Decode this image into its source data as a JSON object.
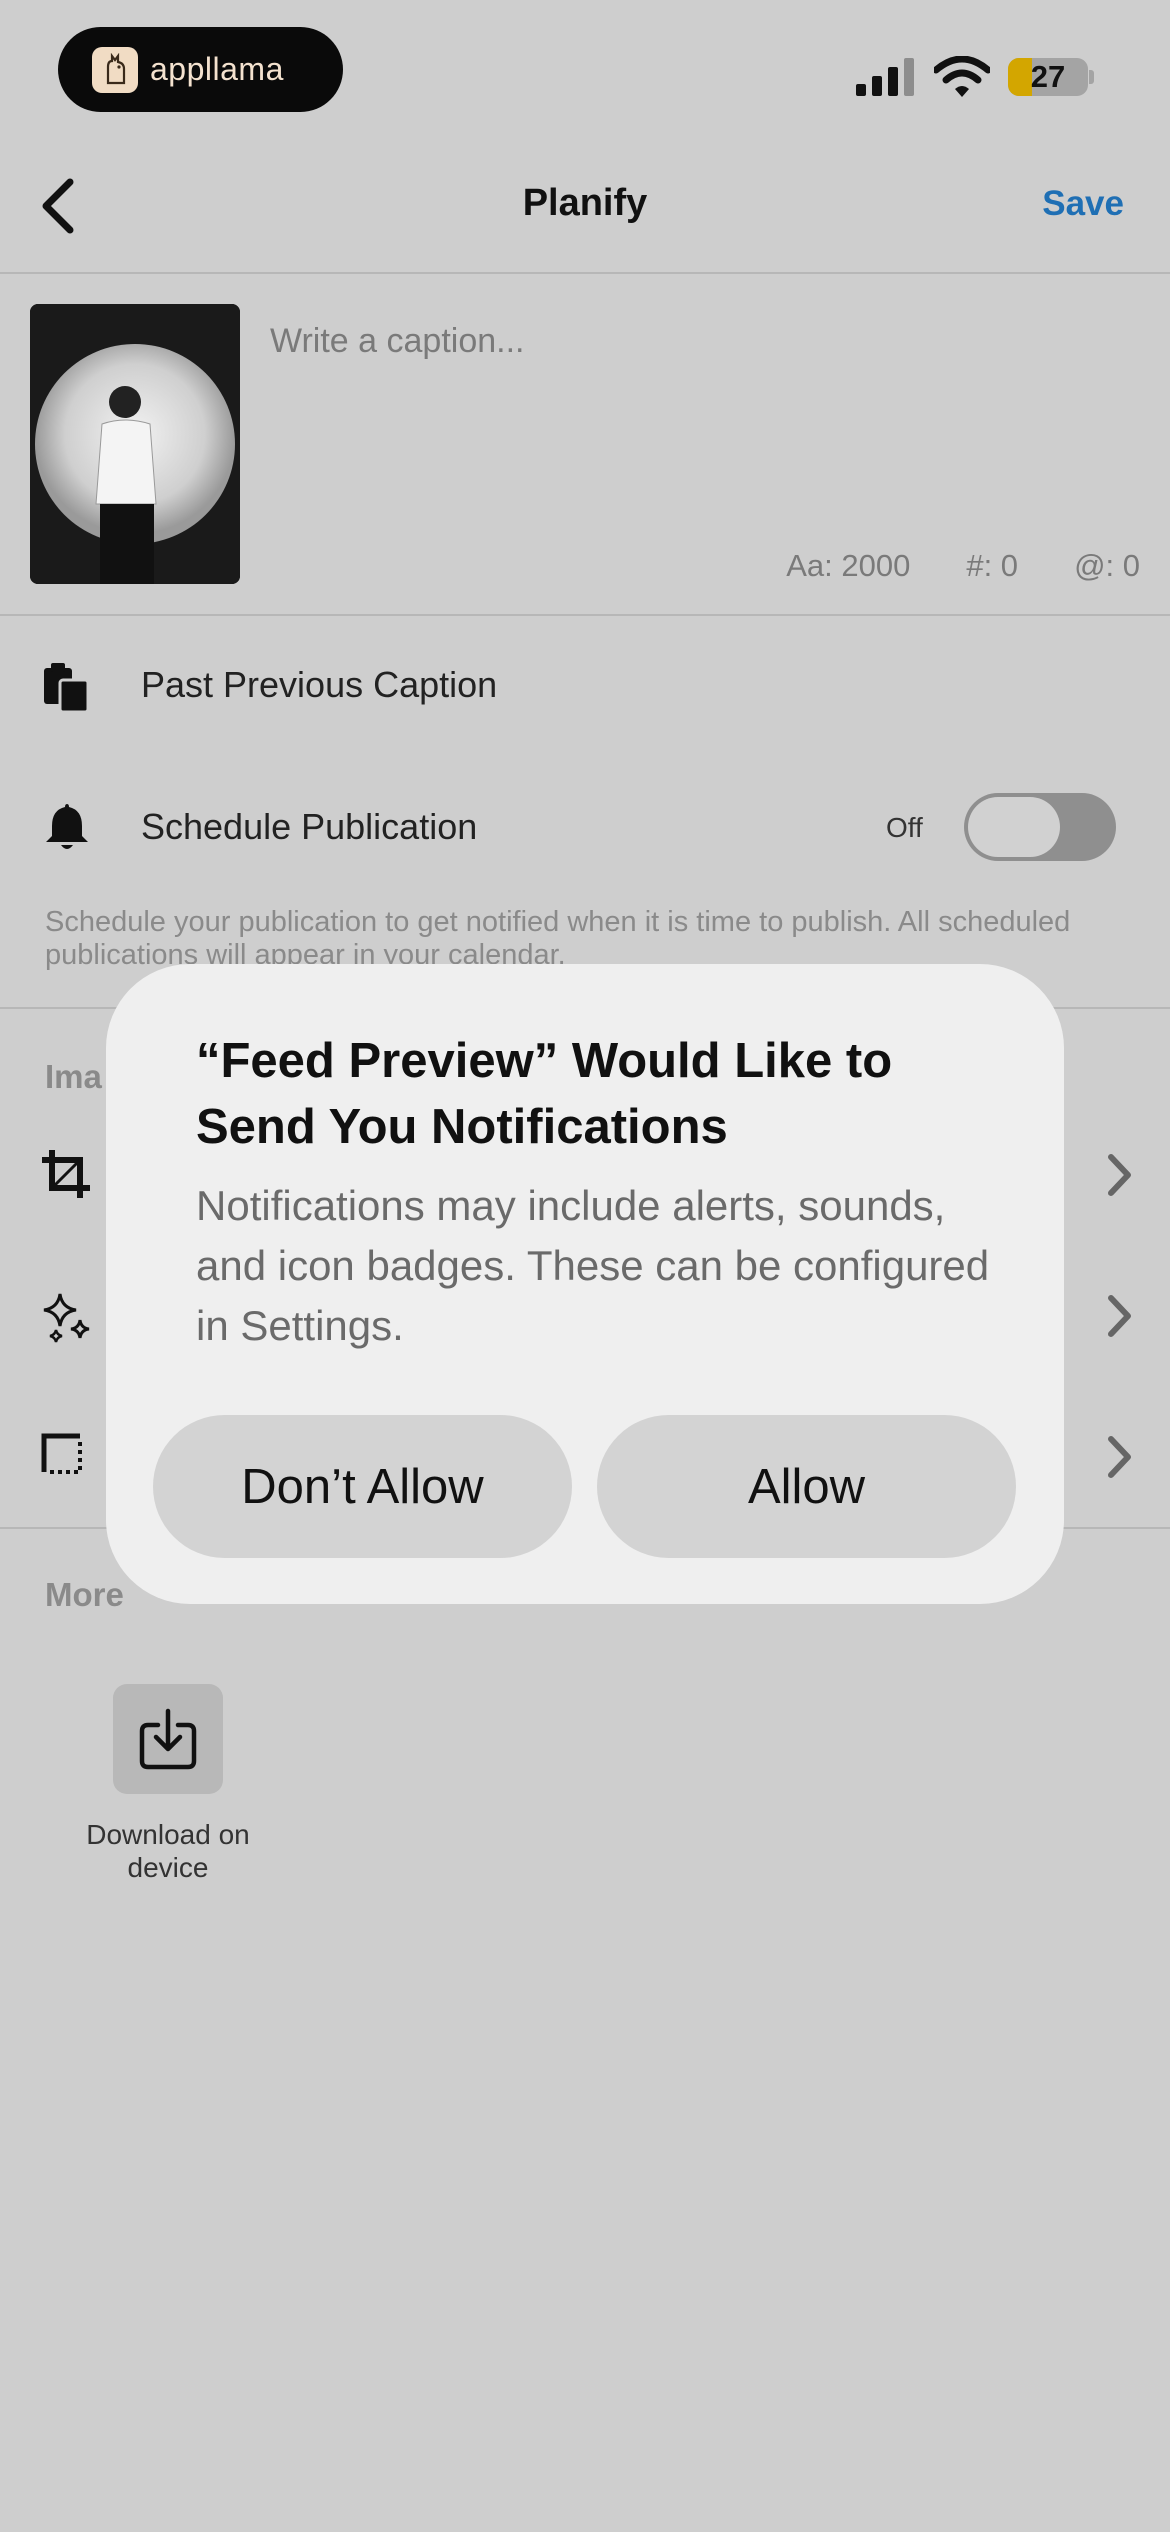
{
  "status_bar": {
    "app_badge_label": "appllama",
    "battery_level": "27",
    "icons": [
      "cellular-signal-icon",
      "wifi-icon",
      "battery-icon"
    ]
  },
  "nav": {
    "back_icon": "chevron-left-icon",
    "title": "Planify",
    "save_label": "Save"
  },
  "caption": {
    "placeholder": "Write a caption...",
    "chars": "Aa: 2000",
    "hashtags": "#: 0",
    "mentions": "@: 0"
  },
  "rows": {
    "paste_label": "Past Previous Caption",
    "schedule_label": "Schedule Publication",
    "toggle_state": "Off",
    "schedule_hint": "Schedule your publication to get notified when it is time to publish. All scheduled publications will appear in your calendar."
  },
  "image_section": {
    "label": "Ima"
  },
  "more_section": {
    "label": "More",
    "download_label": "Download on device"
  },
  "dialog": {
    "title": "“Feed Preview” Would Like to Send You Notifications",
    "body": "Notifications may include alerts, sounds, and icon badges. These can be configured in Settings.",
    "deny_label": "Don’t Allow",
    "allow_label": "Allow"
  },
  "colors": {
    "background": "#cecece",
    "accent": "#1f6fb4",
    "dialog": "#efefef",
    "battery": "#d3a600"
  }
}
